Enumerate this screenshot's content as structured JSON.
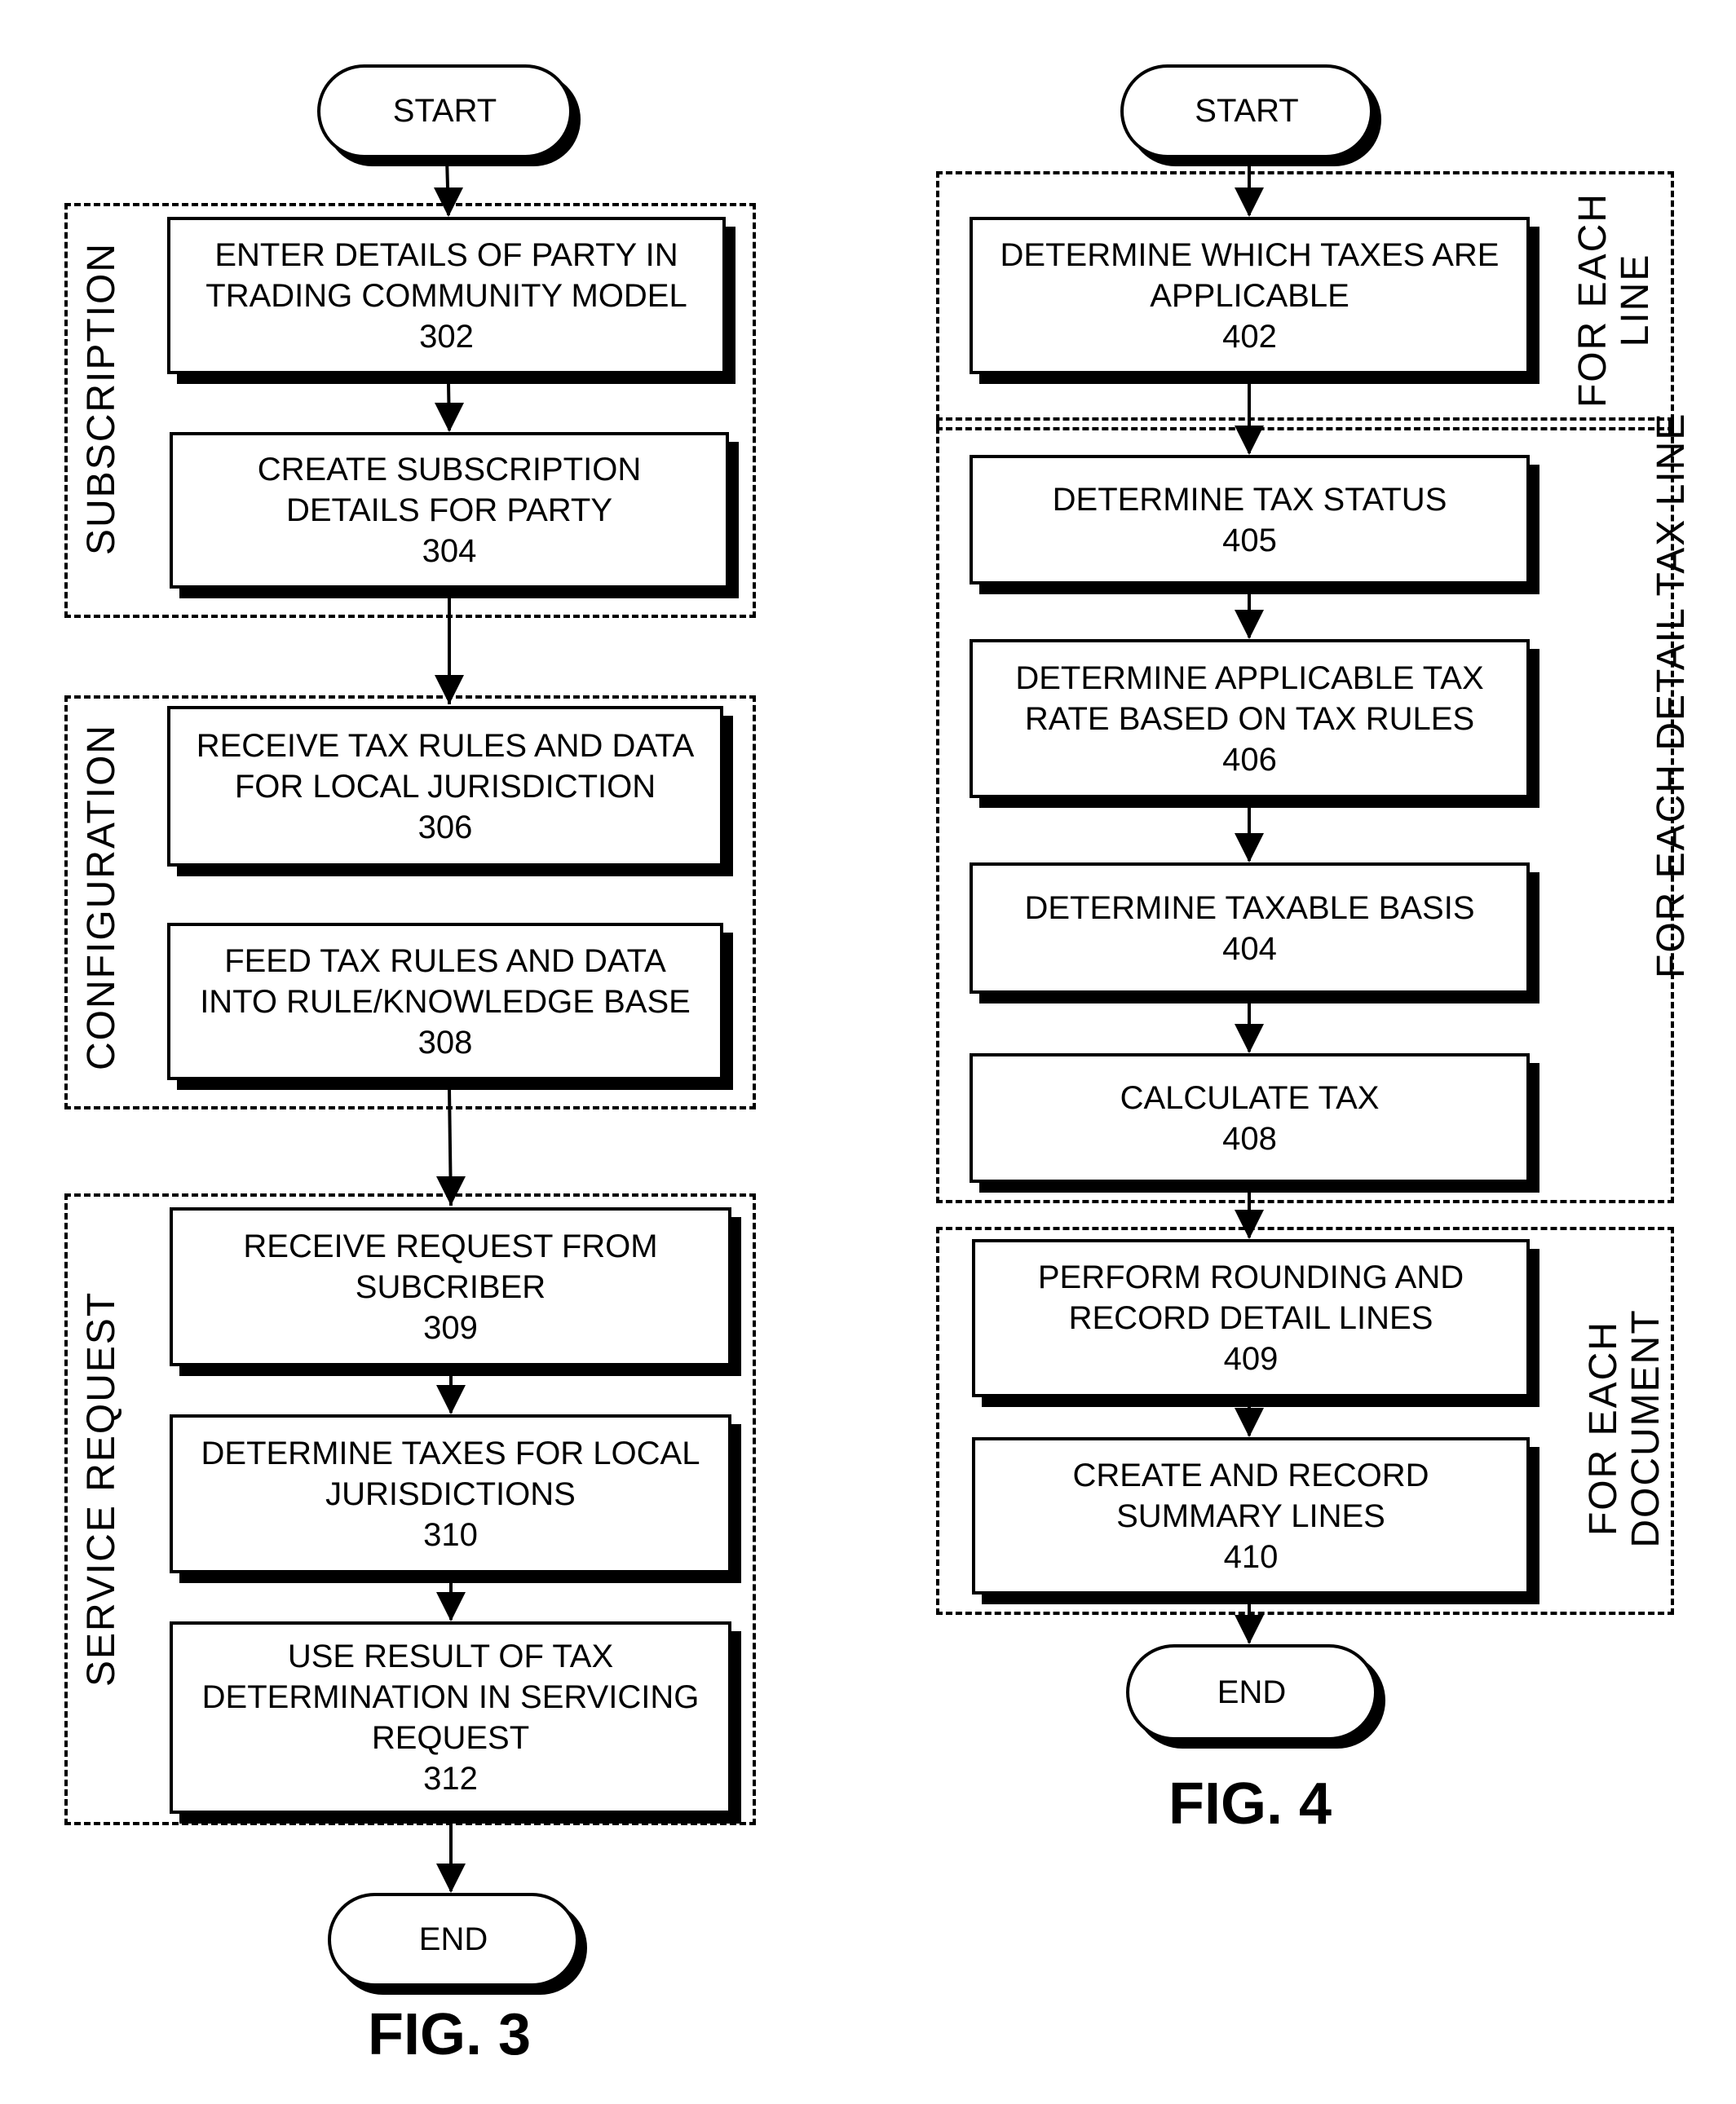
{
  "fig3": {
    "caption": "FIG. 3",
    "start": "START",
    "end": "END",
    "groups": {
      "subscription": "SUBSCRIPTION",
      "configuration": "CONFIGURATION",
      "service_request": "SERVICE REQUEST"
    },
    "steps": [
      {
        "lines": [
          "ENTER DETAILS OF PARTY IN",
          "TRADING COMMUNITY MODEL"
        ],
        "ref": "302"
      },
      {
        "lines": [
          "CREATE SUBSCRIPTION",
          "DETAILS FOR PARTY"
        ],
        "ref": "304"
      },
      {
        "lines": [
          "RECEIVE TAX RULES AND DATA",
          "FOR LOCAL JURISDICTION"
        ],
        "ref": "306"
      },
      {
        "lines": [
          "FEED TAX RULES AND DATA",
          "INTO RULE/KNOWLEDGE BASE"
        ],
        "ref": "308"
      },
      {
        "lines": [
          "RECEIVE REQUEST FROM",
          "SUBCRIBER"
        ],
        "ref": "309"
      },
      {
        "lines": [
          "DETERMINE TAXES FOR LOCAL",
          "JURISDICTIONS"
        ],
        "ref": "310"
      },
      {
        "lines": [
          "USE RESULT OF TAX",
          "DETERMINATION IN SERVICING",
          "REQUEST"
        ],
        "ref": "312"
      }
    ]
  },
  "fig4": {
    "caption": "FIG. 4",
    "start": "START",
    "end": "END",
    "groups": {
      "each_line": [
        "FOR EACH",
        "LINE"
      ],
      "each_detail_tax_line": "FOR EACH DETAIL TAX LINE",
      "each_document": [
        "FOR EACH",
        "DOCUMENT"
      ]
    },
    "steps": [
      {
        "lines": [
          "DETERMINE WHICH TAXES ARE",
          "APPLICABLE"
        ],
        "ref": "402"
      },
      {
        "lines": [
          "DETERMINE TAX STATUS"
        ],
        "ref": "405"
      },
      {
        "lines": [
          "DETERMINE APPLICABLE TAX",
          "RATE BASED ON TAX RULES"
        ],
        "ref": "406"
      },
      {
        "lines": [
          "DETERMINE TAXABLE BASIS"
        ],
        "ref": "404"
      },
      {
        "lines": [
          "CALCULATE TAX"
        ],
        "ref": "408"
      },
      {
        "lines": [
          "PERFORM ROUNDING AND",
          "RECORD DETAIL LINES"
        ],
        "ref": "409"
      },
      {
        "lines": [
          "CREATE AND RECORD",
          "SUMMARY LINES"
        ],
        "ref": "410"
      }
    ]
  }
}
